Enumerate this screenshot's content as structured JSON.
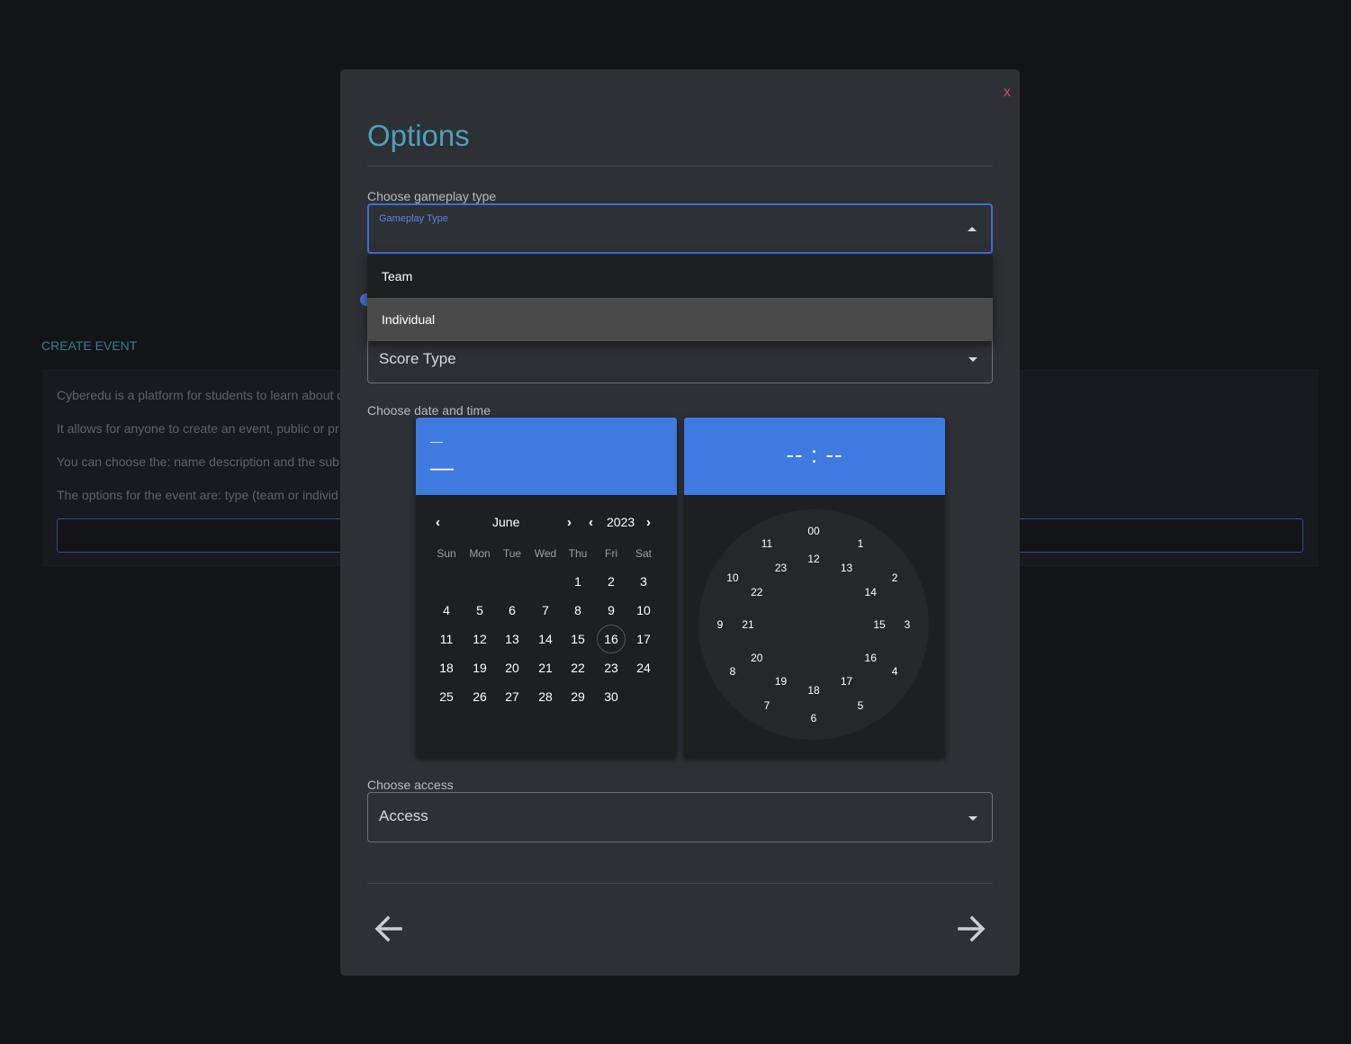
{
  "background": {
    "title": "CREATE EVENT",
    "lines": [
      "Cyberedu is a platform for students to learn about c",
      "It allows for anyone to create an event, public or pr",
      "You can choose the: name description and the sub",
      "The options for the event are: type (team or individ"
    ]
  },
  "modal": {
    "close_label": "x",
    "title": "Options",
    "gameplay": {
      "label": "Choose gameplay type",
      "float_label": "Gameplay Type",
      "options": [
        "Team",
        "Individual"
      ]
    },
    "score": {
      "placeholder": "Score Type"
    },
    "datetime": {
      "label": "Choose date and time",
      "date_year": "—",
      "date_main": "—",
      "time_display": "-- : --",
      "month": "June",
      "year": "2023",
      "weekdays": [
        "Sun",
        "Mon",
        "Tue",
        "Wed",
        "Thu",
        "Fri",
        "Sat"
      ],
      "days": [
        "1",
        "2",
        "3",
        "4",
        "5",
        "6",
        "7",
        "8",
        "9",
        "10",
        "11",
        "12",
        "13",
        "14",
        "15",
        "16",
        "17",
        "18",
        "19",
        "20",
        "21",
        "22",
        "23",
        "24",
        "25",
        "26",
        "27",
        "28",
        "29",
        "30"
      ],
      "today": "16",
      "outer_hours": [
        "00",
        "1",
        "2",
        "3",
        "4",
        "5",
        "6",
        "7",
        "8",
        "9",
        "10",
        "11"
      ],
      "inner_hours": [
        "12",
        "13",
        "14",
        "15",
        "16",
        "17",
        "18",
        "19",
        "20",
        "21",
        "22",
        "23"
      ]
    },
    "access": {
      "label": "Choose access",
      "placeholder": "Access"
    }
  },
  "colors": {
    "accent": "#3e7ae0",
    "title": "#4fa0ba",
    "close": "#d94566"
  }
}
